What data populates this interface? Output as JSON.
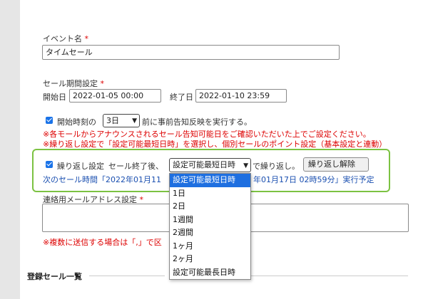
{
  "event_name": {
    "label": "イベント名",
    "required_mark": "*",
    "value": "タイムセール"
  },
  "sale_period": {
    "label": "セール期間設定",
    "required_mark": "*",
    "start_label": "開始日",
    "start_value": "2022-01-05 00:00",
    "end_label": "終了日",
    "end_value": "2022-01-10 23:59"
  },
  "notice": {
    "prefix": "開始時刻の",
    "select_value": "3日",
    "suffix": "前に事前告知反映を実行する。",
    "warn1": "※各モールからアナウンスされるセール告知可能日をご確認いただいた上でご設定ください。",
    "warn2": "※繰り返し設定で「設定可能最短日時」を選択し、個別セールのポイント設定（基本設定と連動）"
  },
  "repeat": {
    "checkbox_label": "繰り返し設定",
    "text_before": "セール終了後、",
    "select_value": "設定可能最短日時",
    "text_after": "で繰り返し。",
    "cancel_button": "繰り返し解除",
    "next_left": "次のセール時間「2022年01月11",
    "next_right": "年01月17日 02時59分」実行予定",
    "options": [
      "設定可能最短日時",
      "1日",
      "2日",
      "1週間",
      "2週間",
      "1ヶ月",
      "2ヶ月",
      "設定可能最長日時"
    ],
    "selected_index": 0
  },
  "email": {
    "label": "連絡用メールアドレス設定",
    "required_mark": "*",
    "note_left": "※複数に送信する場合は「,」で区"
  },
  "section": {
    "title": "登録セール一覧"
  },
  "colors": {
    "accent_green": "#7cc242",
    "selected_blue": "#1e6fe0",
    "warning_red": "#dd0000",
    "link_blue": "#1a4fb0"
  }
}
